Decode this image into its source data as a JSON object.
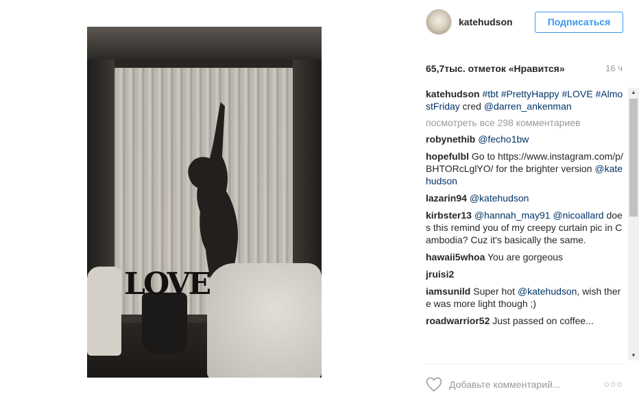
{
  "post": {
    "photo_alt": "LOVE"
  },
  "header": {
    "username": "katehudson",
    "follow_label": "Подписаться"
  },
  "stats": {
    "likes": "65,7тыс. отметок «Нравится»",
    "time": "16 ч"
  },
  "caption": {
    "user": "katehudson",
    "parts": [
      "#tbt",
      " ",
      "#PrettyHappy",
      " ",
      "#LOVE",
      " ",
      "#AlmostFriday",
      " cred ",
      "@darren_ankenman"
    ]
  },
  "more_comments_label": "посмотреть все 298 комментариев",
  "comments": [
    {
      "user": "robynethib",
      "text_tag": "@fecho1bw",
      "text": " "
    },
    {
      "user": "hopefulbl",
      "text": "Go to https://www.instagram.com/p/BHTORcLglYO/ for the brighter version ",
      "text_tag": "@katehudson"
    },
    {
      "user": "lazarin94",
      "text_tag": "@katehudson",
      "text": ""
    },
    {
      "user": "kirbster13",
      "text_tag": "@hannah_may91 @nicoallard",
      "text": " does this remind you of my creepy curtain pic in Cambodia? Cuz it's basically the same."
    },
    {
      "user": "hawaii5whoa",
      "text": "You are gorgeous",
      "text_tag": ""
    },
    {
      "user": "jruisi2",
      "text": "",
      "text_tag": ""
    },
    {
      "user": "iamsunild",
      "text": "Super hot ",
      "text_tag": "@katehudson",
      "text_after": ", wish there was more light though ;)"
    },
    {
      "user": "roadwarrior52",
      "text": "Just passed on coffee...",
      "text_tag": ""
    }
  ],
  "add_comment": {
    "placeholder": "Добавьте комментарий..."
  },
  "icons": {
    "like": "heart-icon",
    "options": "more-options-icon"
  },
  "colors": {
    "link": "#003569",
    "follow": "#3897f0"
  }
}
